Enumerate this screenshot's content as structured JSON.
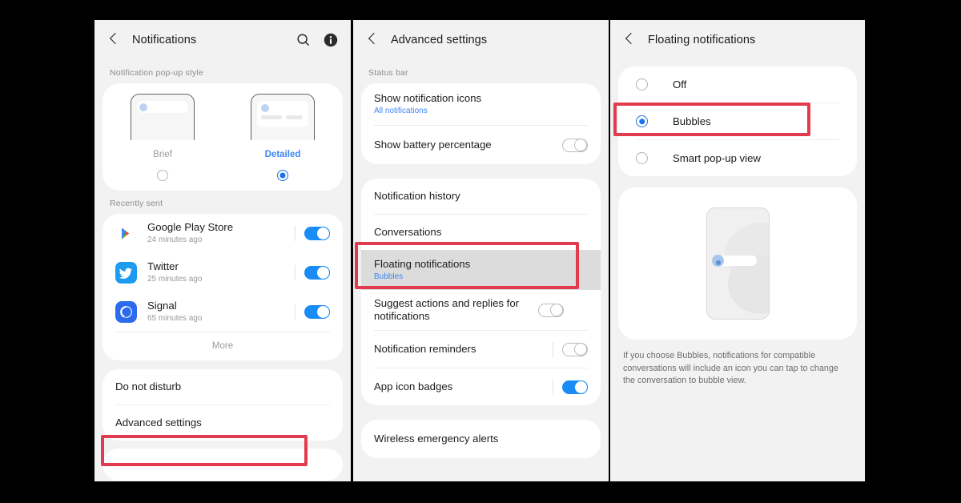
{
  "panels": {
    "left": {
      "header": {
        "title": "Notifications",
        "back_icon": "chevron-left-icon",
        "search_icon": "search-icon",
        "info_icon": "info-icon"
      },
      "popup_style": {
        "section_label": "Notification pop-up style",
        "options": [
          {
            "name": "Brief",
            "selected": false
          },
          {
            "name": "Detailed",
            "selected": true
          }
        ]
      },
      "recently_sent": {
        "section_label": "Recently sent",
        "apps": [
          {
            "name": "Google Play Store",
            "time": "24 minutes ago",
            "toggle": "on",
            "icon": "google-play-icon"
          },
          {
            "name": "Twitter",
            "time": "25 minutes ago",
            "toggle": "on",
            "icon": "twitter-icon"
          },
          {
            "name": "Signal",
            "time": "65 minutes ago",
            "toggle": "on",
            "icon": "signal-icon"
          }
        ],
        "more_label": "More"
      },
      "bottom_rows": [
        {
          "label": "Do not disturb",
          "highlighted": false
        },
        {
          "label": "Advanced settings",
          "highlighted": true
        }
      ]
    },
    "middle": {
      "header": {
        "title": "Advanced settings",
        "back_icon": "chevron-left-icon"
      },
      "status_bar": {
        "section_label": "Status bar",
        "rows": [
          {
            "label": "Show notification icons",
            "sublabel": "All notifications",
            "control": "none"
          },
          {
            "label": "Show battery percentage",
            "sublabel": "",
            "control": "toggle-off"
          }
        ]
      },
      "main_rows": [
        {
          "label": "Notification history",
          "sublabel": "",
          "control": "none",
          "highlighted": false
        },
        {
          "label": "Conversations",
          "sublabel": "",
          "control": "none",
          "highlighted": false
        },
        {
          "label": "Floating notifications",
          "sublabel": "Bubbles",
          "control": "none",
          "highlighted": true
        },
        {
          "label": "Suggest actions and replies for notifications",
          "sublabel": "",
          "control": "toggle-off",
          "highlighted": false
        },
        {
          "label": "Notification reminders",
          "sublabel": "",
          "control": "toggle-off",
          "highlighted": false
        },
        {
          "label": "App icon badges",
          "sublabel": "",
          "control": "toggle-on",
          "highlighted": false
        }
      ],
      "footer_rows": [
        {
          "label": "Wireless emergency alerts"
        }
      ]
    },
    "right": {
      "header": {
        "title": "Floating notifications",
        "back_icon": "chevron-left-icon"
      },
      "options": [
        {
          "label": "Off",
          "selected": false,
          "highlighted": false
        },
        {
          "label": "Bubbles",
          "selected": true,
          "highlighted": true
        },
        {
          "label": "Smart pop-up view",
          "selected": false,
          "highlighted": false
        }
      ],
      "preview": {
        "illustration": "bubble-preview-illustration"
      },
      "note": "If you choose Bubbles, notifications for compatible conversations will include an icon you can tap to change the conversation to bubble view."
    }
  },
  "colors": {
    "highlight": "#e23b4e",
    "accent_blue": "#3d86f5",
    "toggle_on": "#1a8cf5",
    "background": "#000000",
    "panel_bg": "#f2f2f2"
  }
}
